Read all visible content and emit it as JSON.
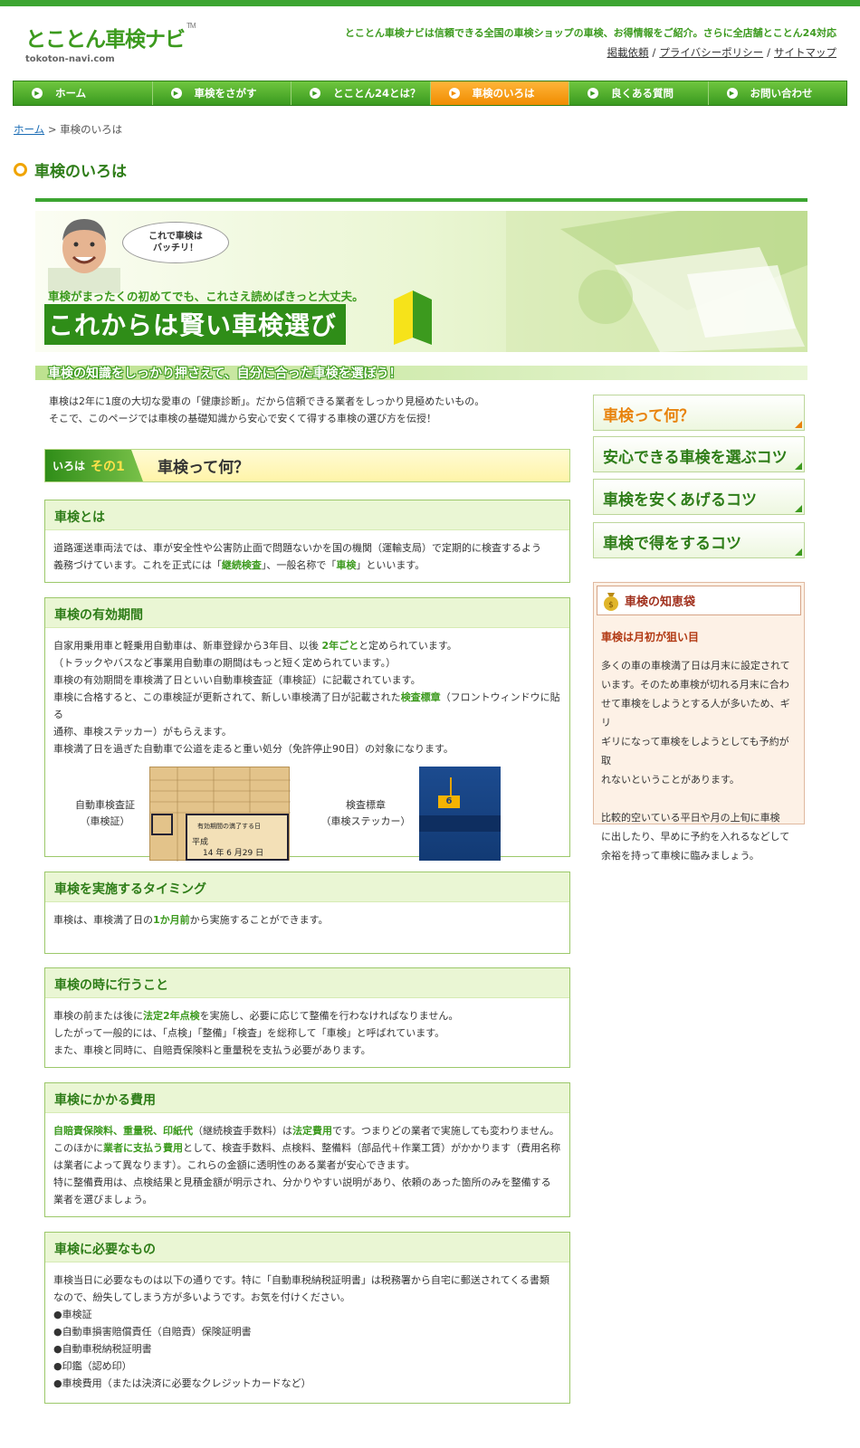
{
  "site": {
    "logo": "とことん車検ナビ",
    "logo_tm": "TM",
    "domain": "tokoton-navi.com",
    "tagline": "とことん車検ナビは信頼できる全国の車検ショップの車検、お得情報をご紹介。さらに全店舗とことん24対応",
    "links": [
      "掲載依頼",
      "プライバシーポリシー",
      "サイトマップ"
    ]
  },
  "nav": [
    {
      "label": "ホーム",
      "active": false
    },
    {
      "label": "車検をさがす",
      "active": false
    },
    {
      "label": "とことん24とは？",
      "active": false
    },
    {
      "label": "車検のいろは",
      "active": true
    },
    {
      "label": "良くある質問",
      "active": false
    },
    {
      "label": "お問い合わせ",
      "active": false
    }
  ],
  "breadcrumb": {
    "home": "ホーム",
    "sep": ">",
    "current": "車検のいろは"
  },
  "page_title": "車検のいろは",
  "hero": {
    "bubble_1": "これで車検は",
    "bubble_2": "バッチリ！",
    "sub": "車検がまったくの初めてでも、これさえ読めばきっと大丈夫。",
    "main": "これからは賢い車検選び"
  },
  "strip": "車検の知識をしっかり押さえて、自分に合った車検を選ぼう！",
  "intro": [
    "車検は2年に1度の大切な愛車の「健康診断」。だから信頼できる業者をしっかり見極めたいもの。",
    "そこで、このページでは車検の基礎知識から安心で安くて得する車検の選び方を伝授！"
  ],
  "section": {
    "badge_a": "いろは",
    "badge_b": "その1",
    "title": "車検って何？"
  },
  "boxes": {
    "b1": {
      "title": "車検とは",
      "t1": "道路運送車両法では、車が安全性や公害防止面で問題ないかを国の機関（運輸支局）で定期的に検査するよう",
      "t2a": "義務づけています。これを正式には「",
      "t2b": "継続検査",
      "t2c": "」、一般名称で「",
      "t2d": "車検",
      "t2e": "」といいます。"
    },
    "b2": {
      "title": "車検の有効期間",
      "l1a": "自家用乗用車と軽乗用自動車は、新車登録から3年目、以後 ",
      "l1b": "2年ごと",
      "l1c": "と定められています。",
      "l2": "（トラックやバスなど事業用自動車の期間はもっと短く定められています。）",
      "l3": "車検の有効期間を車検満了日といい自動車検査証（車検証）に記載されています。",
      "l4a": "車検に合格すると、この車検証が更新されて、新しい車検満了日が記載された",
      "l4b": "検査標章",
      "l4c": "（フロントウィンドウに貼る",
      "l5": "通称、車検ステッカー）がもらえます。",
      "l6": "車検満了日を過ぎた自動車で公道を走ると重い処分（免許停止90日）の対象になります。",
      "fig1_1": "自動車検査証",
      "fig1_2": "（車検証）",
      "fig2_1": "検査標章",
      "fig2_2": "（車検ステッカー）",
      "doc_head": "有効期間の満了する日",
      "doc_era": "平成",
      "doc_date": "14 年 6 月29 日",
      "sticker_no": "6"
    },
    "b3": {
      "title": "車検を実施するタイミング",
      "ta": "車検は、車検満了日の",
      "tb": "1か月前",
      "tc": "から実施することができます。"
    },
    "b4": {
      "title": "車検の時に行うこと",
      "l1a": "車検の前または後に",
      "l1b": "法定2年点検",
      "l1c": "を実施し、必要に応じて整備を行わなければなりません。",
      "l2": "したがって一般的には、「点検」「整備」「検査」を総称して「車検」と呼ばれています。",
      "l3": "また、車検と同時に、自賠責保険料と重量税を支払う必要があります。"
    },
    "b5": {
      "title": "車検にかかる費用",
      "l1a": "自賠責保険料、重量税、印紙代",
      "l1b": "（継続検査手数料）は",
      "l1c": "法定費用",
      "l1d": "です。つまりどの業者で実施しても変わりません。",
      "l2a": "このほかに",
      "l2b": "業者に支払う費用",
      "l2c": "として、検査手数料、点検料、整備料（部品代＋作業工賃）がかかります（費用名称",
      "l3": "は業者によって異なります）。これらの金額に透明性のある業者が安心できます。",
      "l4": "特に整備費用は、点検結果と見積金額が明示され、分かりやすい説明があり、依頼のあった箇所のみを整備する",
      "l5": "業者を選びましょう。"
    },
    "b6": {
      "title": "車検に必要なもの",
      "l1": "車検当日に必要なものは以下の通りです。特に「自動車税納税証明書」は税務署から自宅に郵送されてくる書類",
      "l2": "なので、紛失してしまう方が多いようです。お気を付けください。",
      "items": [
        "●車検証",
        "●自動車損害賠償責任（自賠責）保険証明書",
        "●自動車税納税証明書",
        "●印鑑（認め印）",
        "●車検費用（または決済に必要なクレジットカードなど）"
      ]
    }
  },
  "side_menu": [
    {
      "label": "車検って何？",
      "color": "#e8830c"
    },
    {
      "label": "安心できる車検を選ぶコツ",
      "color": "#2e7d18"
    },
    {
      "label": "車検を安くあげるコツ",
      "color": "#2e7d18"
    },
    {
      "label": "車検で得をするコツ",
      "color": "#2e7d18"
    }
  ],
  "tips": {
    "title": "車検の知恵袋",
    "subtitle": "車検は月初が狙い目",
    "p1": [
      "多くの車の車検満了日は月末に設定されて",
      "います。そのため車検が切れる月末に合わ",
      "せて車検をしようとする人が多いため、ギリ",
      "ギリになって車検をしようとしても予約が取",
      "れないということがあります。"
    ],
    "p2": [
      "比較的空いている平日や月の上旬に車検",
      "に出したり、早めに予約を入れるなどして",
      "余裕を持って車検に臨みましょう。"
    ]
  }
}
